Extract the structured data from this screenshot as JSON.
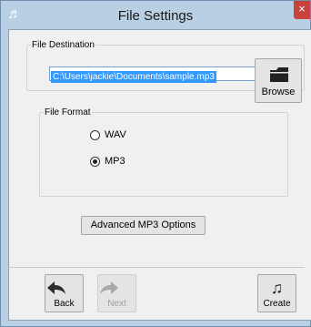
{
  "window": {
    "title": "File Settings",
    "close_glyph": "×"
  },
  "destination": {
    "legend": "File Destination",
    "path_value": "C:\\Users\\jackie\\Documents\\sample.mp3",
    "browse_label": "Browse"
  },
  "format": {
    "legend": "File Format",
    "options": [
      {
        "label": "WAV",
        "selected": false
      },
      {
        "label": "MP3",
        "selected": true
      }
    ]
  },
  "advanced_button_label": "Advanced MP3 Options",
  "navigation": {
    "back_label": "Back",
    "next_label": "Next",
    "create_label": "Create"
  },
  "colors": {
    "accent_blue": "#3399ff",
    "close_red": "#c7433b",
    "titlebar": "#b9cfe4"
  }
}
